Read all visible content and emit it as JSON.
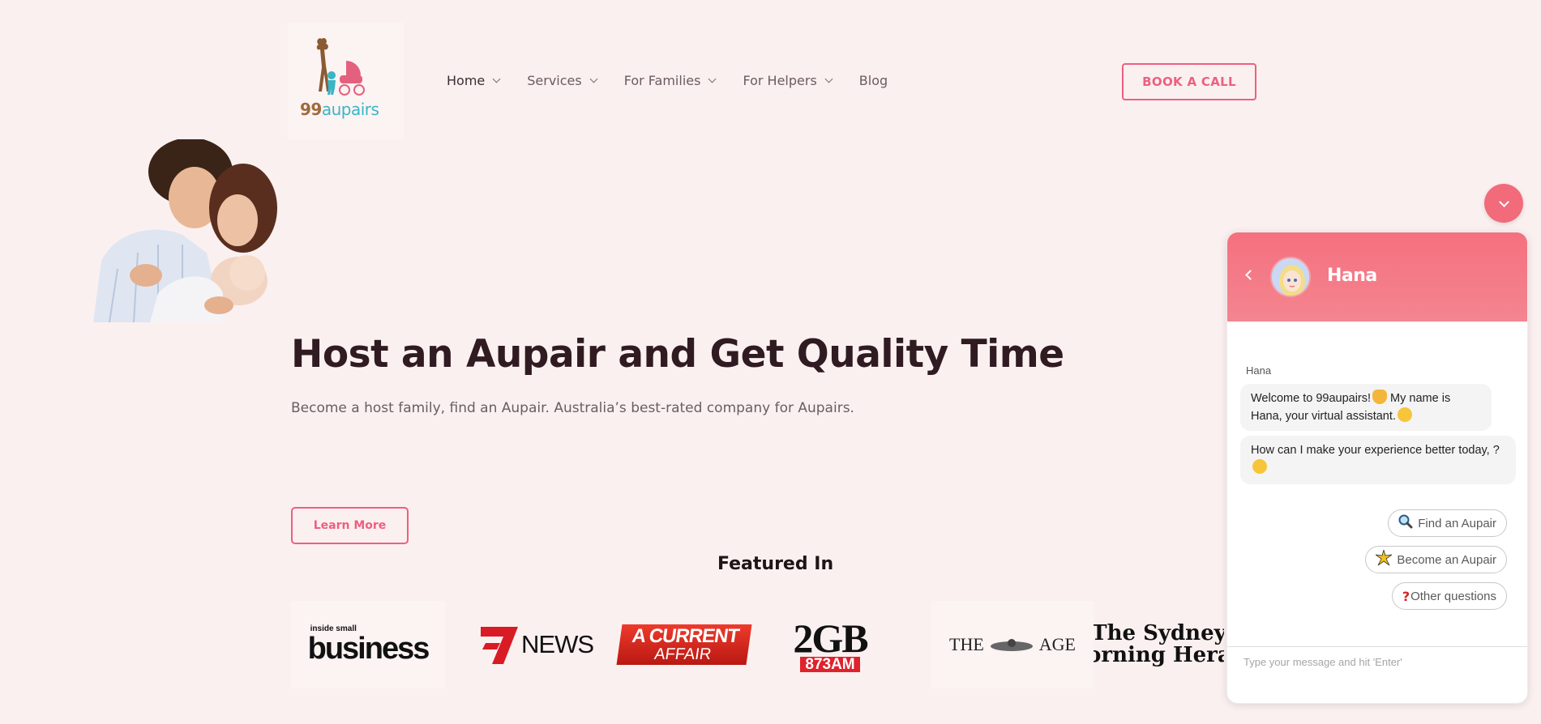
{
  "header": {
    "logo_text_a": "99",
    "logo_text_b": "aupairs",
    "nav": [
      {
        "label": "Home",
        "has_dropdown": true
      },
      {
        "label": "Services",
        "has_dropdown": true
      },
      {
        "label": "For Families",
        "has_dropdown": true
      },
      {
        "label": "For Helpers",
        "has_dropdown": true
      },
      {
        "label": "Blog",
        "has_dropdown": false
      }
    ],
    "cta": "BOOK A CALL"
  },
  "hero": {
    "title": "Host an Aupair and Get Quality Time",
    "subtitle": "Become a host family, find an Aupair. Australia’s best-rated company for Aupairs.",
    "button": "Learn More"
  },
  "featured": {
    "heading": "Featured In",
    "logos": [
      {
        "name": "inside small business",
        "top": "inside small",
        "main": "business"
      },
      {
        "name": "7NEWS",
        "main": "NEWS"
      },
      {
        "name": "A Current Affair",
        "line1": "A CURRENT",
        "line2": "AFFAIR"
      },
      {
        "name": "2GB 873AM",
        "line1": "2GB",
        "line2": "873AM"
      },
      {
        "name": "The Age",
        "left": "THE",
        "right": "AGE"
      },
      {
        "name": "The Sydney Morning Herald",
        "line1": "The Sydney",
        "line2": "Morning Herald"
      }
    ]
  },
  "chat": {
    "agent_name": "Hana",
    "sender_label": "Hana",
    "messages": [
      {
        "text_a": "Welcome to 99aupairs!",
        "text_b": " My name is Hana, your virtual assistant."
      },
      {
        "text_a": "How can I make your experience better today, ?"
      }
    ],
    "quick_replies": [
      {
        "icon": "magnifier-icon",
        "label": "Find an Aupair"
      },
      {
        "icon": "sparkle-icon",
        "label": "Become an Aupair"
      },
      {
        "icon": "question-icon",
        "label": "Other questions"
      }
    ],
    "input_placeholder": "Type your message and hit 'Enter'"
  },
  "colors": {
    "accent": "#ee5f7f",
    "background": "#fbf0f0",
    "chat_header": "#f5707f"
  }
}
